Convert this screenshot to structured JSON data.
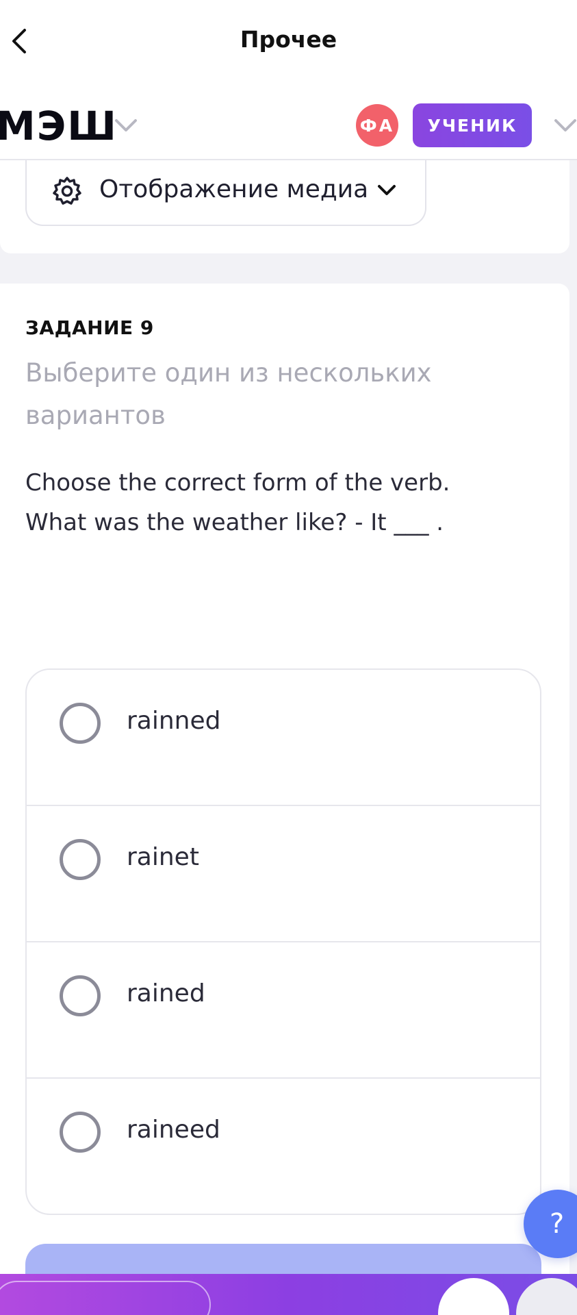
{
  "nav": {
    "title": "Прочее"
  },
  "header": {
    "logo": "МЭШ",
    "avatar_initials": "ФА",
    "role": "УЧЕНИК"
  },
  "media": {
    "label": "Отображение медиа"
  },
  "task": {
    "number": "ЗАДАНИЕ 9",
    "instruction": "Выберите один из нескольких вариантов",
    "question_line1": "Choose the correct form of the verb.",
    "question_line2": "What was the weather like? - It ___ .",
    "options": [
      {
        "label": "rainned",
        "selected": false
      },
      {
        "label": "rainet",
        "selected": false
      },
      {
        "label": "rained",
        "selected": false
      },
      {
        "label": "raineed",
        "selected": false
      }
    ]
  },
  "help": {
    "label": "?"
  },
  "icons": {
    "back": "chevron-left-icon",
    "logo_menu": "chevron-down-icon",
    "role_menu": "chevron-down-icon",
    "media_settings": "gear-icon",
    "media_toggle": "chevron-down-icon"
  },
  "colors": {
    "accent": "#8a45e0",
    "avatar": "#f2616a",
    "submit": "#a9b4f6",
    "help": "#5a7cf6"
  }
}
